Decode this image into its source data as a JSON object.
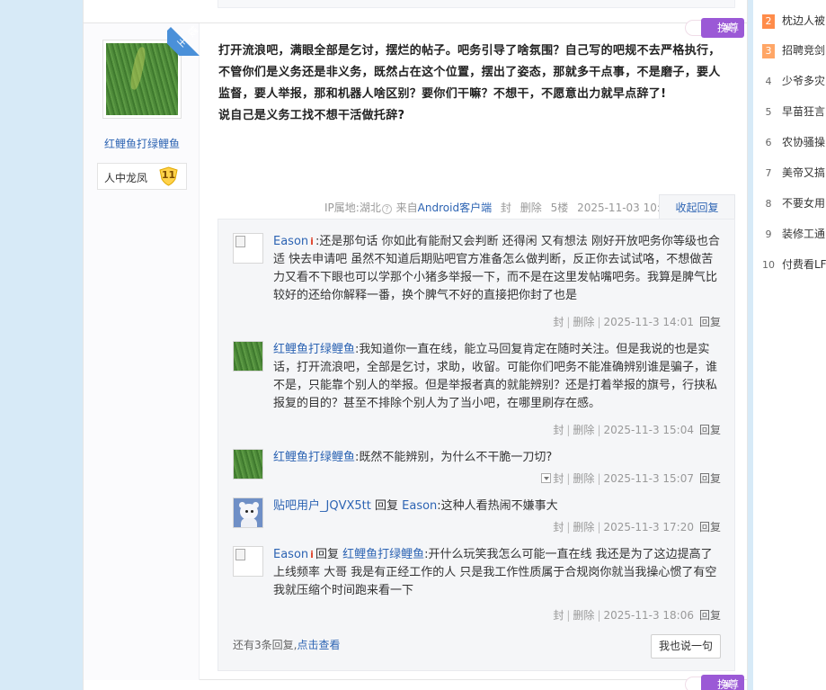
{
  "post": {
    "author": {
      "name": "红鲤鱼打绿鲤鱼",
      "level_title": "人中龙凤",
      "level": "11",
      "louzhu_tag": "楼主"
    },
    "badge_label": "挽尊",
    "text": [
      "打开流浪吧，满眼全部是乞讨，摆烂的帖子。吧务引导了啥氛围？自己写的吧规不去严格执行，不管你们是义务还是非义务，既然占在这个位置，摆出了姿态，那就多干点事，不是磨子，要人监督，要人举报，那和机器人啥区别？要你们干嘛？不想干，不愿意出力就早点辞了!",
      "说自己是义务工找不想干活做托辞?"
    ],
    "meta": {
      "ip": "IP属地:湖北",
      "help_icon": "?",
      "from_prefix": "来自",
      "from_client": "Android客户端",
      "seal": "封",
      "delete": "删除",
      "floor": "5楼",
      "time": "2025-11-03 10:33",
      "collapse_reply": "收起回复"
    }
  },
  "replies": [
    {
      "user": "Eason",
      "vip_icon": "i",
      "reply_to_label": "",
      "reply_to_user": "",
      "text": ":还是那句话 你如此有能耐又会判断 还得闲 又有想法 刚好开放吧务你等级也合适 快去申请吧 虽然不知道后期贴吧官方准备怎么做判断，反正你去试试咯，不想做苦力又看不下眼也可以学那个小猪多举报一下，而不是在这里发帖嘴吧务。我算是脾气比较好的还给你解释一番，换个脾气不好的直接把你封了也是",
      "seal": "封",
      "delete": "删除",
      "time": "2025-11-3 14:01",
      "reply": "回复"
    },
    {
      "user": "红鲤鱼打绿鲤鱼",
      "vip_icon": "",
      "reply_to_label": "",
      "reply_to_user": "",
      "text": ":我知道你一直在线，能立马回复肯定在随时关注。但是我说的也是实话，打开流浪吧，全部是乞讨，求助，收留。可能你们吧务不能准确辨别谁是骗子，谁不是，只能靠个别人的举报。但是举报者真的就能辨别？还是打着举报的旗号，行挟私报复的目的？甚至不排除个别人为了当小吧，在哪里刷存在感。",
      "seal": "封",
      "delete": "删除",
      "time": "2025-11-3 15:04",
      "reply": "回复"
    },
    {
      "user": "红鲤鱼打绿鲤鱼",
      "vip_icon": "",
      "reply_to_label": "",
      "reply_to_user": "",
      "text": ":既然不能辨别，为什么不干脆一刀切?",
      "seal": "封",
      "delete": "删除",
      "time": "2025-11-3 15:07",
      "reply": "回复"
    },
    {
      "user": "贴吧用户_JQVX5tt",
      "vip_icon": "",
      "reply_to_label": "回复",
      "reply_to_user": "Eason",
      "text": ":这种人看热闹不嫌事大",
      "seal": "封",
      "delete": "删除",
      "time": "2025-11-3 17:20",
      "reply": "回复"
    },
    {
      "user": "Eason",
      "vip_icon": "i",
      "reply_to_label": "回复",
      "reply_to_user": "红鲤鱼打绿鲤鱼",
      "text": ":开什么玩笑我怎么可能一直在线 我还是为了这边提高了上线频率 大哥 我是有正经工作的人 只是我工作性质属于合规岗你就当我操心惯了有空我就压缩个时间跑来看一下",
      "seal": "封",
      "delete": "删除",
      "time": "2025-11-3 18:06",
      "reply": "回复"
    }
  ],
  "more": {
    "prefix": "还有3条回复,",
    "link": "点击查看",
    "say_button": "我也说一句"
  },
  "hot_list": [
    {
      "rank": "2",
      "title": "枕边人被"
    },
    {
      "rank": "3",
      "title": "招聘竞剑"
    },
    {
      "rank": "4",
      "title": "少爷多灾"
    },
    {
      "rank": "5",
      "title": "早苗狂言"
    },
    {
      "rank": "6",
      "title": "农协骚操"
    },
    {
      "rank": "7",
      "title": "美帝又搞"
    },
    {
      "rank": "8",
      "title": "不要女用"
    },
    {
      "rank": "9",
      "title": "装修工通"
    },
    {
      "rank": "10",
      "title": "付费看LF"
    }
  ],
  "colors": {
    "link_blue": "#2d64b3",
    "badge_purple": "#9b59d6",
    "louzhu_blue": "#4a90d9",
    "rank_orange": "#ff8c4a",
    "vip_red": "#e0462f"
  }
}
